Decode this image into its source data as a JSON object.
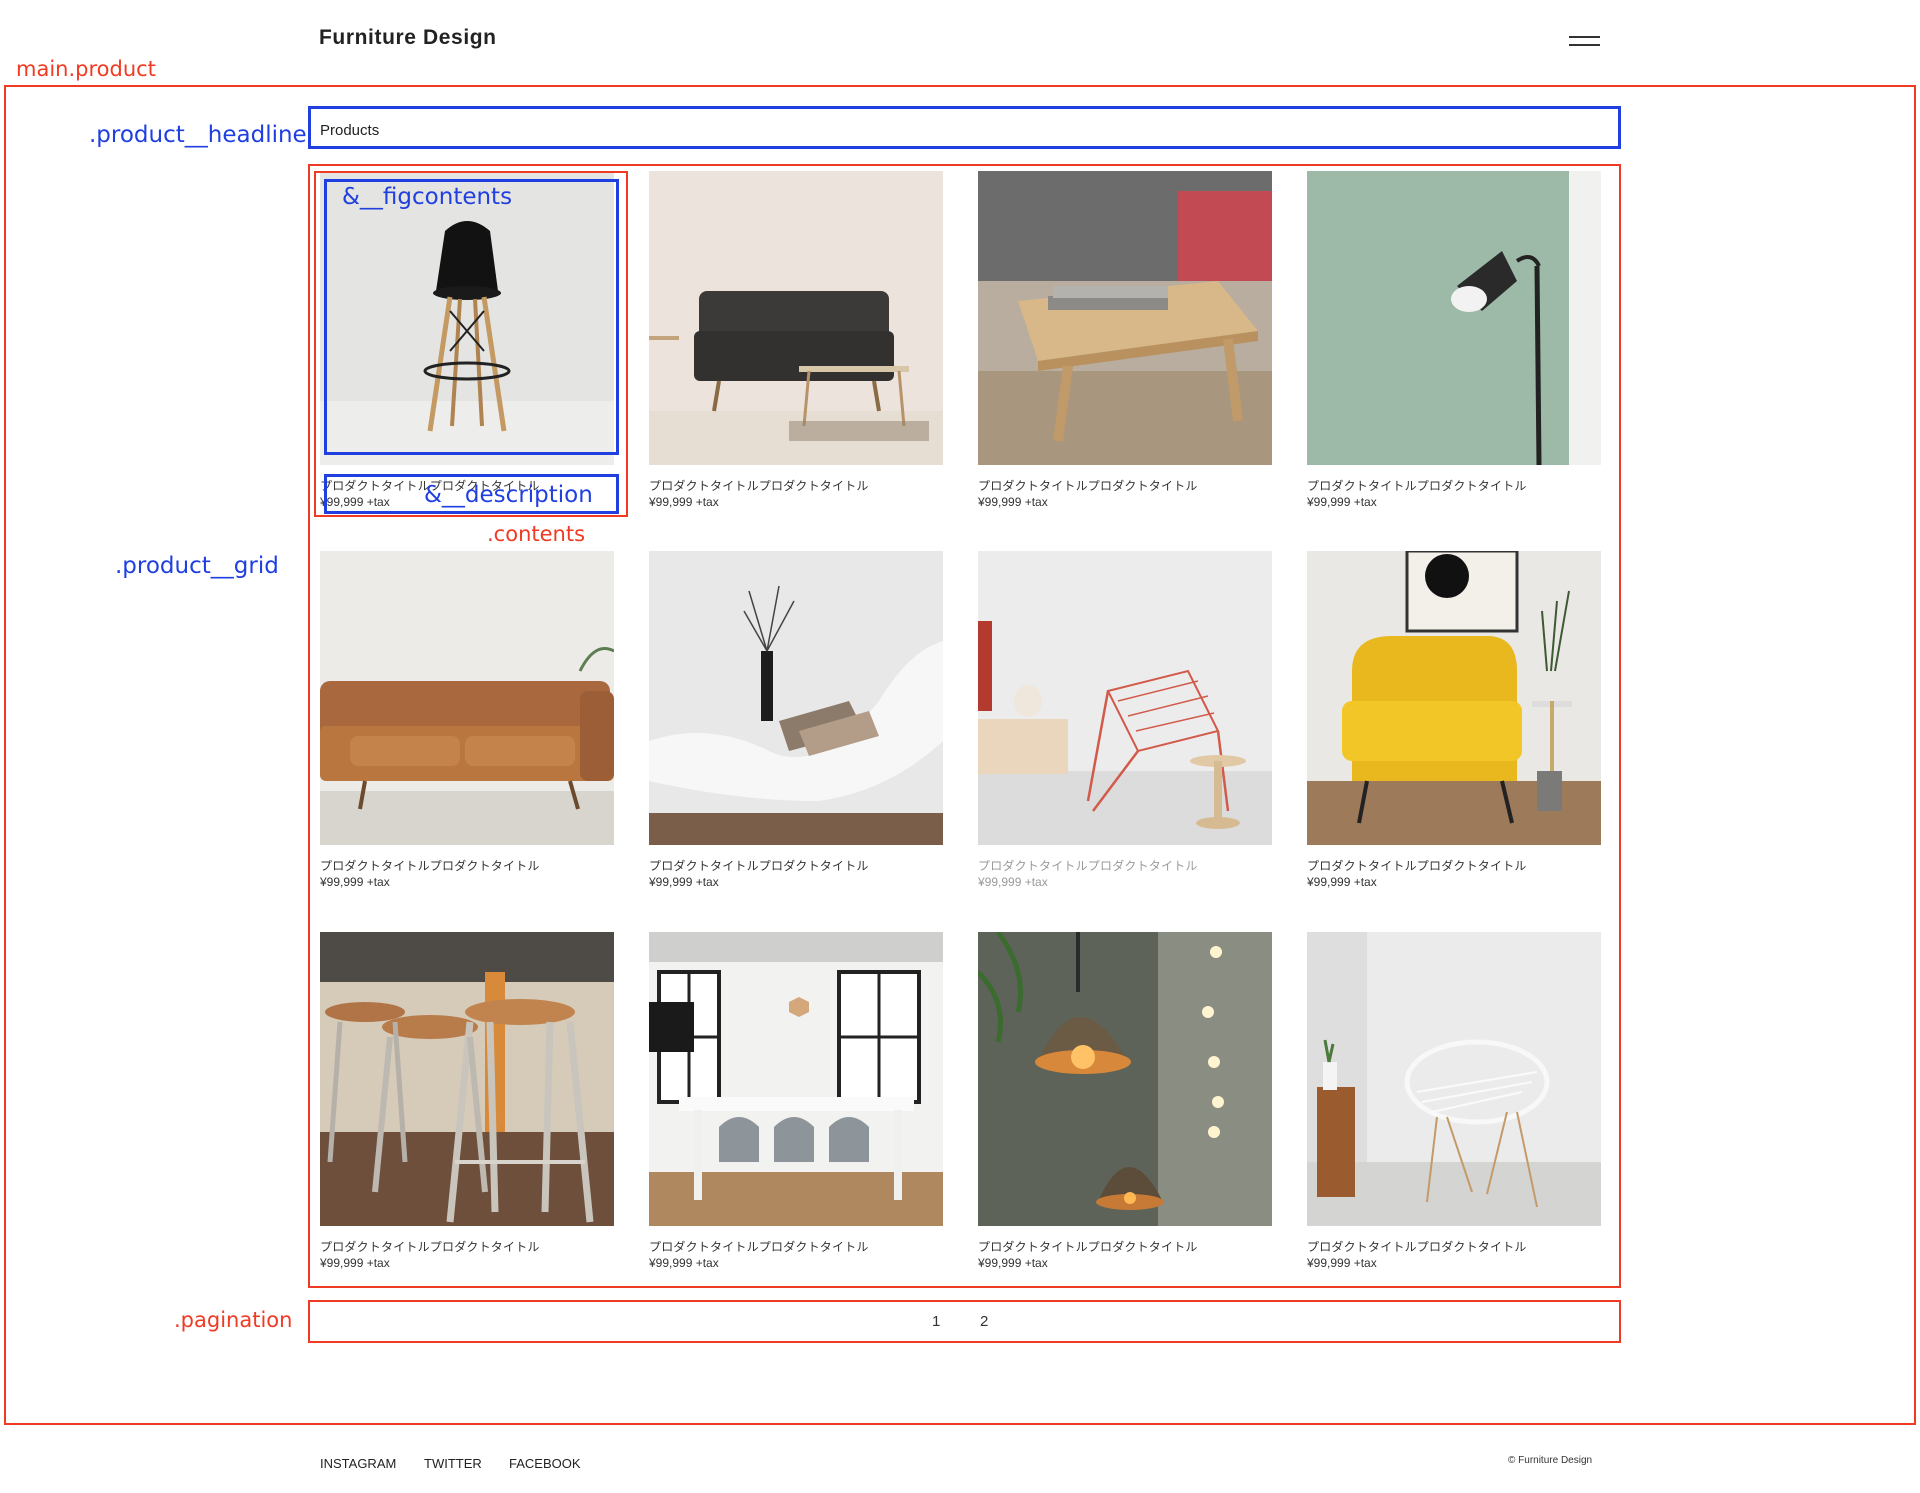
{
  "header": {
    "site_title": "Furniture Design"
  },
  "annotations": {
    "main_product": "main.product",
    "product_headline": ".product__headline",
    "product_grid": ".product__grid",
    "figcontents": "&__figcontents",
    "description": "&__description",
    "contents": ".contents",
    "pagination": ".pagination"
  },
  "headline": "Products",
  "products": [
    {
      "title": "プロダクトタイトルプロダクトタイトル",
      "price": "¥99,999 +tax",
      "image": "bar-stool"
    },
    {
      "title": "プロダクトタイトルプロダクトタイトル",
      "price": "¥99,999 +tax",
      "image": "sofa-living-room"
    },
    {
      "title": "プロダクトタイトルプロダクトタイトル",
      "price": "¥99,999 +tax",
      "image": "wooden-coffee-table"
    },
    {
      "title": "プロダクトタイトルプロダクトタイトル",
      "price": "¥99,999 +tax",
      "image": "floor-lamp"
    },
    {
      "title": "プロダクトタイトルプロダクトタイトル",
      "price": "¥99,999 +tax",
      "image": "leather-sofa"
    },
    {
      "title": "プロダクトタイトルプロダクトタイトル",
      "price": "¥99,999 +tax",
      "image": "white-chaise-lounge"
    },
    {
      "title": "プロダクトタイトルプロダクトタイトル",
      "price": "¥99,999 +tax",
      "image": "wire-chair"
    },
    {
      "title": "プロダクトタイトルプロダクトタイトル",
      "price": "¥99,999 +tax",
      "image": "yellow-armchair"
    },
    {
      "title": "プロダクトタイトルプロダクトタイトル",
      "price": "¥99,999 +tax",
      "image": "industrial-stools"
    },
    {
      "title": "プロダクトタイトルプロダクトタイトル",
      "price": "¥99,999 +tax",
      "image": "dining-room"
    },
    {
      "title": "プロダクトタイトルプロダクトタイトル",
      "price": "¥99,999 +tax",
      "image": "pendant-lamps"
    },
    {
      "title": "プロダクトタイトルプロダクトタイトル",
      "price": "¥99,999 +tax",
      "image": "white-wire-chair"
    }
  ],
  "pagination": [
    "1",
    "2"
  ],
  "footer": {
    "links": [
      "INSTAGRAM",
      "TWITTER",
      "FACEBOOK"
    ],
    "copyright": "© Furniture Design"
  },
  "colors": {
    "annotation_red": "#ef3b24",
    "annotation_blue": "#1f3fe0"
  }
}
